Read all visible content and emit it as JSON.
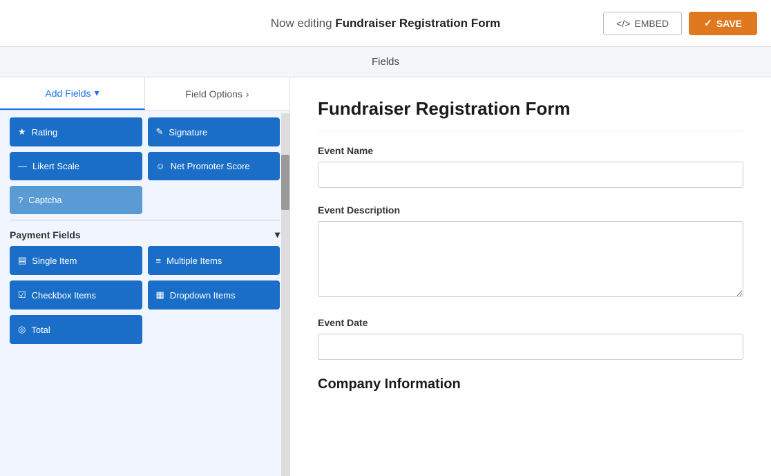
{
  "topbar": {
    "editing_label": "Now editing ",
    "form_name": "Fundraiser Registration Form",
    "embed_label": "EMBED",
    "save_label": "SAVE",
    "embed_icon": "</>",
    "save_icon": "✓"
  },
  "fields_bar": {
    "label": "Fields"
  },
  "left_panel": {
    "tab_add": "Add Fields",
    "tab_add_icon": "▾",
    "tab_options": "Field Options",
    "tab_options_icon": "›",
    "fields_row1": [
      {
        "icon": "★",
        "label": "Rating"
      },
      {
        "icon": "✎",
        "label": "Signature"
      }
    ],
    "fields_row2": [
      {
        "icon": "—",
        "label": "Likert Scale"
      },
      {
        "icon": "☺",
        "label": "Net Promoter Score"
      }
    ],
    "fields_row3": [
      {
        "icon": "?",
        "label": "Captcha"
      }
    ],
    "payment_section": "Payment Fields",
    "payment_fields_row1": [
      {
        "icon": "▤",
        "label": "Single Item"
      },
      {
        "icon": "≡",
        "label": "Multiple Items"
      }
    ],
    "payment_fields_row2": [
      {
        "icon": "☑",
        "label": "Checkbox Items"
      },
      {
        "icon": "▦",
        "label": "Dropdown Items"
      }
    ],
    "payment_fields_row3": [
      {
        "icon": "◎",
        "label": "Total"
      }
    ]
  },
  "form": {
    "title": "Fundraiser Registration Form",
    "fields": [
      {
        "label": "Event Name",
        "type": "input",
        "placeholder": ""
      },
      {
        "label": "Event Description",
        "type": "textarea",
        "placeholder": ""
      },
      {
        "label": "Event Date",
        "type": "input",
        "placeholder": ""
      }
    ],
    "section": "Company Information"
  }
}
